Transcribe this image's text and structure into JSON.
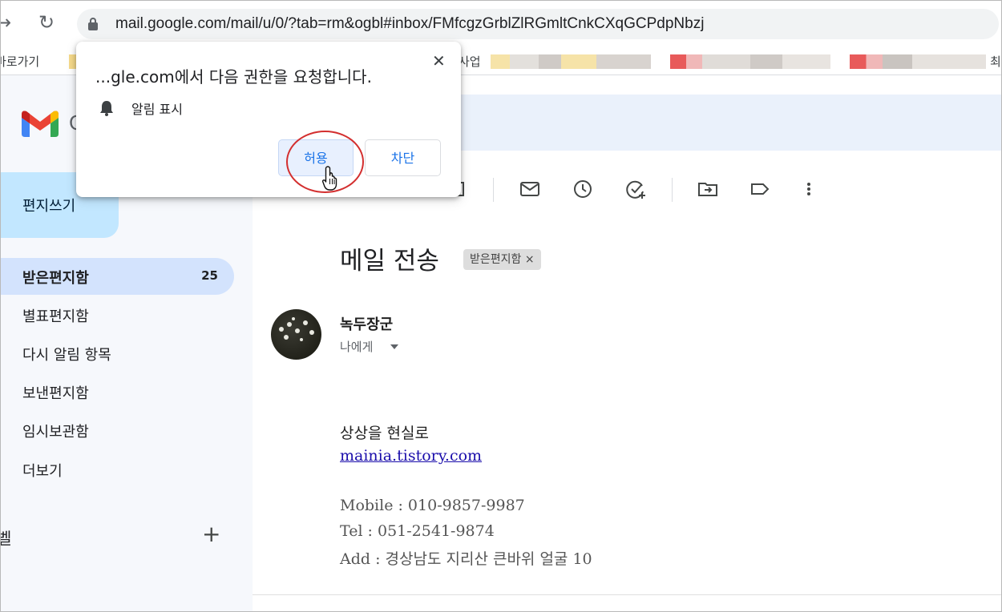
{
  "browser": {
    "url": "mail.google.com/mail/u/0/?tab=rm&ogbl#inbox/FMfcgzGrblZlRGmltCnkCXqGCPdpNbzj",
    "back_icon": "back-arrow-icon",
    "reload_icon": "reload-icon",
    "bookmarks": {
      "first_label": "바로가기",
      "second_label": "사업",
      "last_label": "최"
    }
  },
  "permission_popup": {
    "title": "...gle.com에서 다음 권한을 요청합니다.",
    "permission": "알림 표시",
    "allow_label": "허용",
    "block_label": "차단",
    "close_label": "✕",
    "highlight_color": "#d32f2f"
  },
  "sidebar": {
    "logo_letter": "G",
    "compose_label": "편지쓰기",
    "items": [
      {
        "label": "받은편지함",
        "count": "25",
        "active": true
      },
      {
        "label": "별표편지함"
      },
      {
        "label": "다시 알림 항목"
      },
      {
        "label": "보낸편지함"
      },
      {
        "label": "임시보관함"
      },
      {
        "label": "더보기"
      }
    ],
    "labels_heading": "벨",
    "add_label": "+"
  },
  "toolbar": {
    "icons": [
      "mark-unread-icon",
      "snooze-icon",
      "add-task-icon",
      "move-to-icon",
      "label-icon",
      "more-vert-icon"
    ]
  },
  "message": {
    "subject": "메일 전송",
    "label_chip": "받은편지함",
    "chip_close": "×",
    "sender": "녹두장군",
    "recipient": "나에게",
    "body": {
      "line1": "상상을 현실로",
      "link": "mainia.tistory.com",
      "mobile": "Mobile : 010-9857-9987",
      "tel": "Tel : 051-2541-9874",
      "address": "Add : 경상남도 지리산 큰바위 얼굴 10"
    }
  },
  "colors": {
    "accent": "#1a73e8",
    "active_nav": "#d3e3fd",
    "compose": "#c2e7ff",
    "sidebar_bg": "#f6f8fc"
  }
}
